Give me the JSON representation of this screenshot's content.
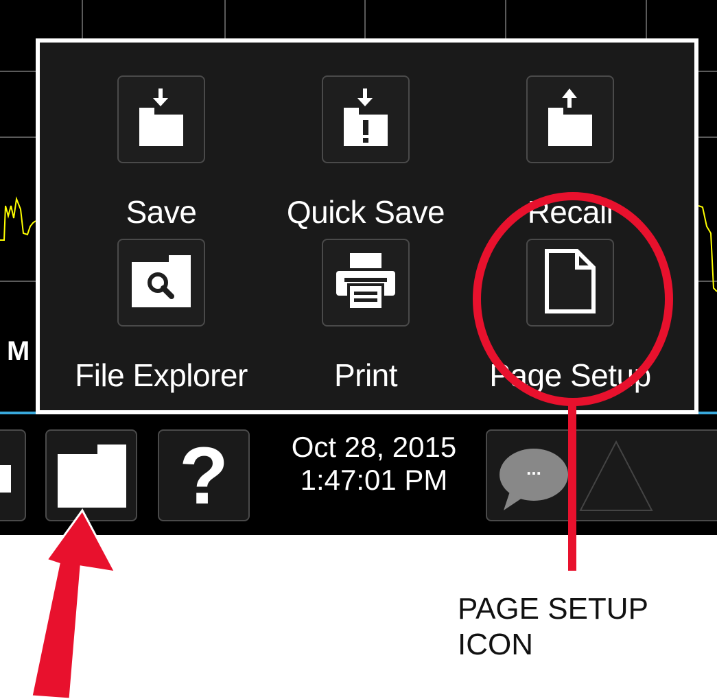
{
  "menu": {
    "items": [
      {
        "label": "Save",
        "icon": "save-folder-icon"
      },
      {
        "label": "Quick Save",
        "icon": "quick-save-folder-icon"
      },
      {
        "label": "Recall",
        "icon": "recall-folder-icon"
      },
      {
        "label": "File Explorer",
        "icon": "file-explorer-icon"
      },
      {
        "label": "Print",
        "icon": "printer-icon"
      },
      {
        "label": "Page Setup",
        "icon": "page-setup-icon"
      }
    ]
  },
  "taskbar": {
    "date": "Oct 28, 2015",
    "time": "1:47:01 PM",
    "help_glyph": "?",
    "messages_glyph": "..."
  },
  "background": {
    "partial_text": "M"
  },
  "annotation": {
    "caption_line1": "PAGE SETUP",
    "caption_line2": "ICON",
    "circle_color": "#e8112d",
    "arrow_color": "#e8112d"
  },
  "colors": {
    "screen_bg": "#000000",
    "menu_bg": "#1a1a1a",
    "menu_border": "#ffffff",
    "trace": "#ffff00",
    "accent_line": "#39a9dc"
  }
}
